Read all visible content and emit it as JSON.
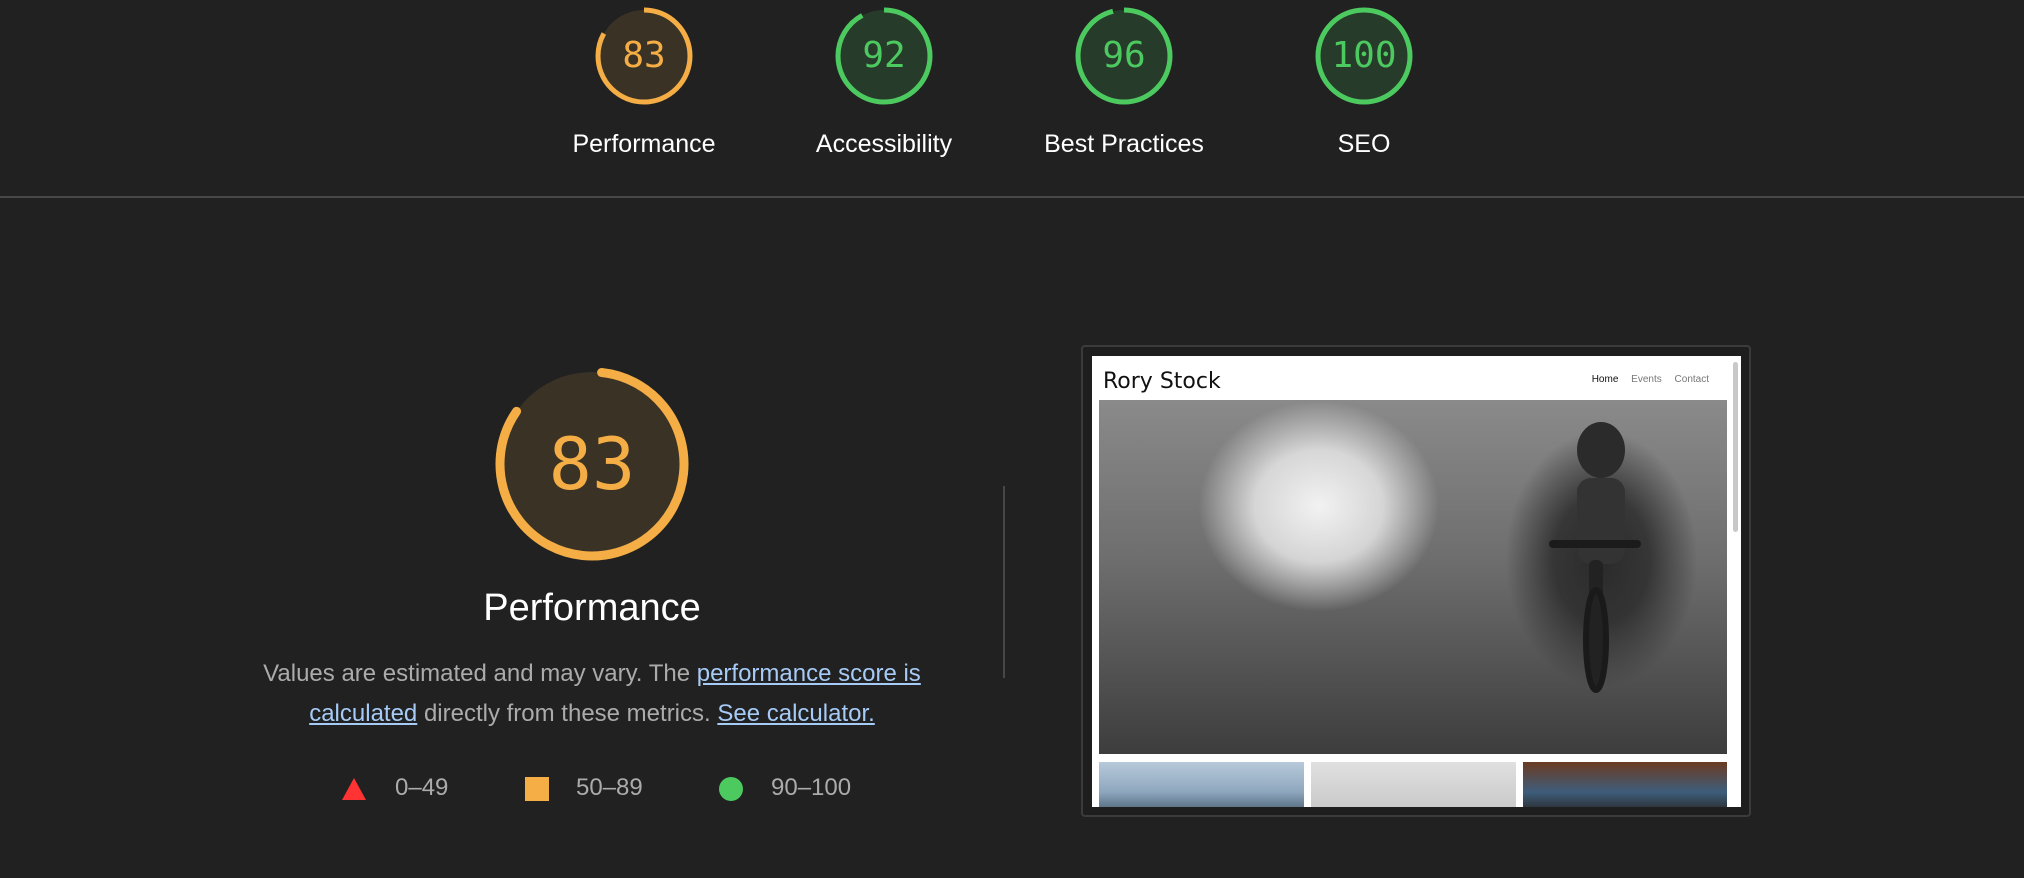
{
  "summary_gauges": [
    {
      "score": "83",
      "label": "Performance",
      "color": "#f4ae45"
    },
    {
      "score": "92",
      "label": "Accessibility",
      "color": "#4cca60"
    },
    {
      "score": "96",
      "label": "Best Practices",
      "color": "#4cca60"
    },
    {
      "score": "100",
      "label": "SEO",
      "color": "#4cca60"
    }
  ],
  "performance": {
    "score": "83",
    "title": "Performance",
    "desc_prefix": "Values are estimated and may vary. The ",
    "link_calculated": "performance score is calculated",
    "desc_middle": " directly from these metrics. ",
    "link_calculator": "See calculator."
  },
  "legend": [
    {
      "shape": "triangle",
      "range": "0–49",
      "color": "#f33"
    },
    {
      "shape": "square",
      "range": "50–89",
      "color": "#f4ae45"
    },
    {
      "shape": "circle",
      "range": "90–100",
      "color": "#4cca60"
    }
  ],
  "screenshot_preview": {
    "site_title": "Rory Stock",
    "nav": [
      "Home",
      "Events",
      "Contact"
    ]
  }
}
